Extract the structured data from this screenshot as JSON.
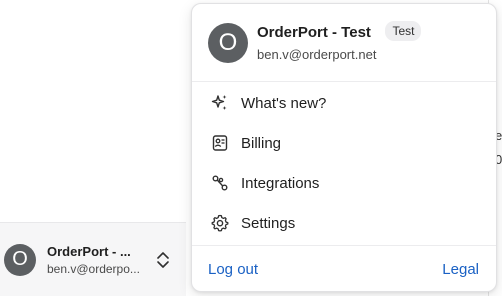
{
  "sidebar": {
    "account": {
      "avatar_initial": "O",
      "name": "OrderPort - ...",
      "email": "ben.v@orderpo..."
    }
  },
  "right_edge": {
    "fragments": [
      "e",
      "0"
    ]
  },
  "menu": {
    "header": {
      "avatar_initial": "O",
      "name": "OrderPort - Test",
      "email": "ben.v@orderport.net",
      "badge": "Test"
    },
    "items": [
      {
        "label": "What's new?",
        "icon": "sparkle-icon"
      },
      {
        "label": "Billing",
        "icon": "billing-icon"
      },
      {
        "label": "Integrations",
        "icon": "integrations-icon"
      },
      {
        "label": "Settings",
        "icon": "gear-icon"
      }
    ],
    "footer": {
      "logout_label": "Log out",
      "legal_label": "Legal"
    }
  },
  "colors": {
    "link": "#1a61c4",
    "avatar_bg": "#5c5f62",
    "badge_bg": "#eeeef0"
  }
}
